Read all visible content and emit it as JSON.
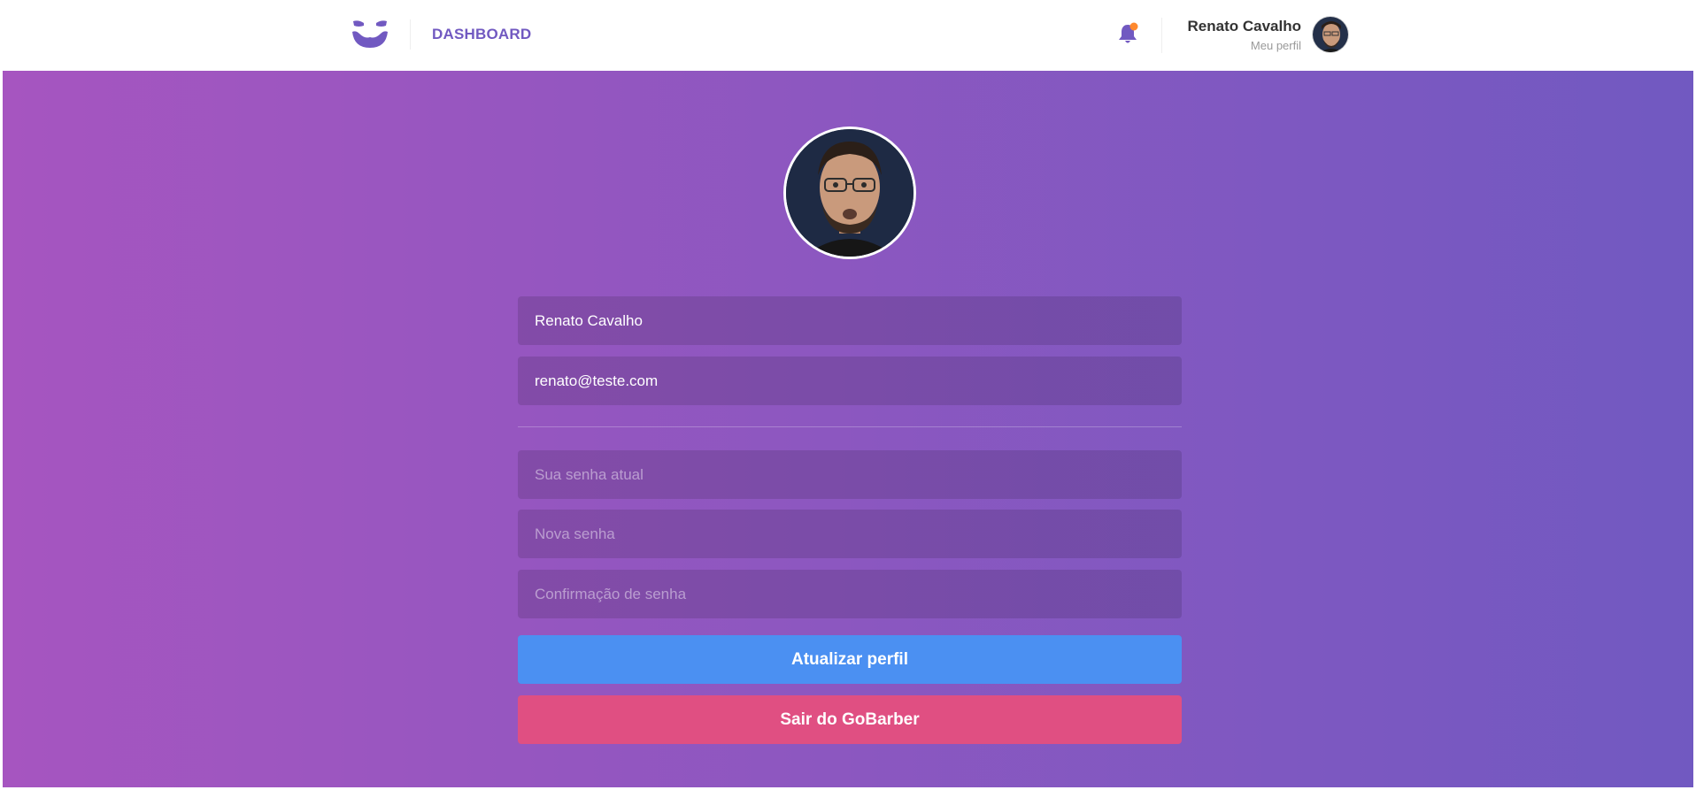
{
  "header": {
    "logo_icon": "mustache-logo-icon",
    "nav_link": "DASHBOARD",
    "notification_icon": "bell-icon",
    "notification_badge_color": "#ff892e",
    "user_name": "Renato Cavalho",
    "profile_link": "Meu perfil",
    "accent_color": "#7159c1"
  },
  "profile_form": {
    "name_value": "Renato Cavalho",
    "email_value": "renato@teste.com",
    "old_password_placeholder": "Sua senha atual",
    "new_password_placeholder": "Nova senha",
    "confirm_password_placeholder": "Confirmação de senha",
    "submit_label": "Atualizar perfil",
    "submit_color": "#4b90f2",
    "logout_label": "Sair do GoBarber",
    "logout_color": "#e04f82"
  },
  "background_gradient": [
    "#a655c0",
    "#7159c1"
  ]
}
